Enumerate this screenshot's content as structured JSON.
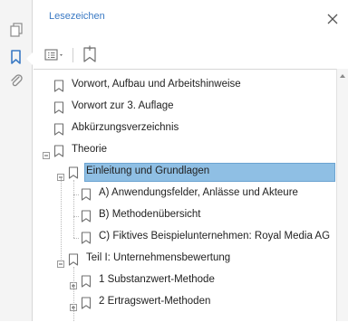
{
  "panel": {
    "title": "Lesezeichen"
  },
  "icons": {
    "pages": "pages-icon",
    "bookmarks": "bookmark-panel-icon",
    "attachments": "paperclip-icon",
    "close": "close-icon",
    "options": "options-menu-icon",
    "new_bookmark": "new-bookmark-icon",
    "bookmark": "bookmark-icon",
    "expand": "expand-icon",
    "collapse": "collapse-icon"
  },
  "colors": {
    "selection": "#8fbfe4",
    "title": "#3b7ac4",
    "active_rail": "#3b7ac4"
  },
  "bookmarks": [
    {
      "label": "Vorwort, Aufbau und Arbeitshinweise",
      "level": 0,
      "expander": "none"
    },
    {
      "label": "Vorwort zur 3. Auflage",
      "level": 0,
      "expander": "none"
    },
    {
      "label": "Abkürzungsverzeichnis",
      "level": 0,
      "expander": "none"
    },
    {
      "label": "Theorie",
      "level": 0,
      "expander": "collapse"
    },
    {
      "label": "Einleitung und Grundlagen",
      "level": 1,
      "expander": "collapse",
      "selected": true
    },
    {
      "label": "A) Anwendungsfelder, Anlässe und Akteure",
      "level": 2,
      "expander": "none"
    },
    {
      "label": "B) Methodenübersicht",
      "level": 2,
      "expander": "none"
    },
    {
      "label": "C) Fiktives Beispielunternehmen: Royal Media AG",
      "level": 2,
      "expander": "none"
    },
    {
      "label": "Teil I: Unternehmensbewertung",
      "level": 1,
      "expander": "collapse"
    },
    {
      "label": "1 Substanzwert-Methode",
      "level": 2,
      "expander": "expand"
    },
    {
      "label": "2 Ertragswert-Methoden",
      "level": 2,
      "expander": "expand"
    }
  ]
}
